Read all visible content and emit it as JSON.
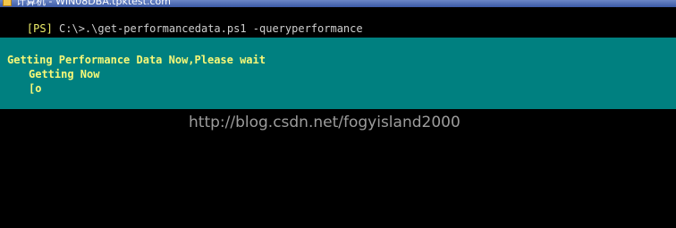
{
  "window": {
    "title": "计算机 - WIN08DBA.tpktest.com"
  },
  "console": {
    "prompt_tag": "[PS]",
    "command": " C:\\>.\\get-performancedata.ps1 -queryperformance"
  },
  "progress": {
    "activity": "Getting Performance Data Now,Please wait",
    "status": "Getting Now",
    "bar": "[o"
  },
  "watermark": {
    "text": "http://blog.csdn.net/fogyisland2000"
  },
  "colors": {
    "console_background": "#000000",
    "progress_background": "#008080",
    "progress_text": "#f8f878",
    "prompt_tag": "#f0f06a"
  }
}
